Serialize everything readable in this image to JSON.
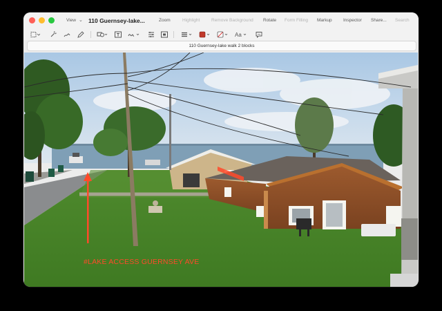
{
  "window": {
    "title": "110 Guernsey-lake...",
    "filename": "110 Guernsey-lake walk 2 blocks"
  },
  "menu": {
    "view": "View",
    "zoom": "Zoom",
    "highlight": "Highlight",
    "remove_background": "Remove Background",
    "rotate": "Rotate",
    "form_filling": "Form Filling",
    "markup": "Markup",
    "inspector": "Inspector",
    "share": "Share...",
    "search": "Search"
  },
  "markup_tools": {
    "text_style": "Aa"
  },
  "photo": {
    "annotation": "#LAKE ACCESS GUERNSEY AVE",
    "annotation_color": "#ff4a2a"
  }
}
